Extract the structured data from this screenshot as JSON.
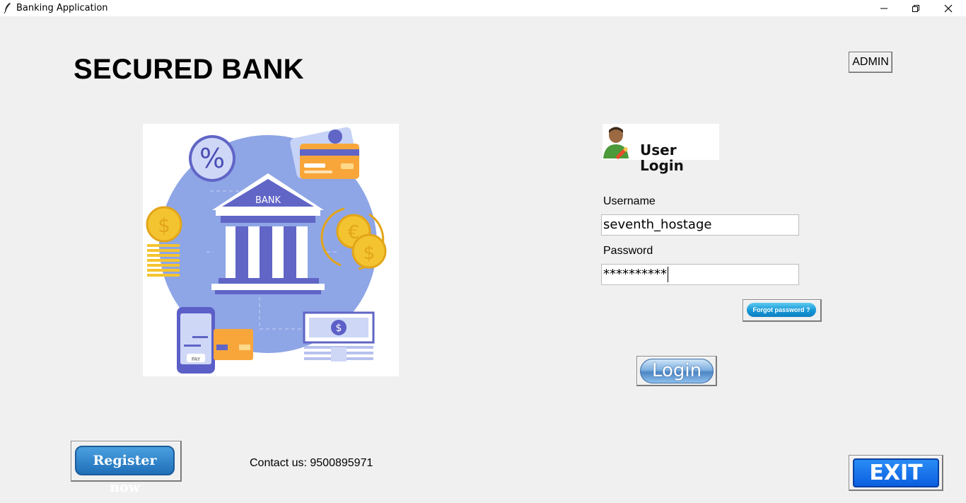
{
  "window": {
    "title": "Banking Application"
  },
  "header": {
    "title": "SECURED BANK",
    "admin_label": "ADMIN"
  },
  "illustration": {
    "bank_sign": "BANK",
    "percent_sign": "%",
    "pay_label": "PAY",
    "euro_sign": "€",
    "dollar_sign": "$"
  },
  "login": {
    "header_text": "User Login",
    "username_label": "Username",
    "username_value": "seventh_hostage",
    "password_label": "Password",
    "password_value": "**********",
    "forgot_label": "Forgot password ?",
    "login_label": "Login"
  },
  "footer": {
    "register_label": "Register now",
    "contact_text": "Contact us: 9500895971",
    "exit_label": "EXIT"
  },
  "colors": {
    "background": "#f0f0f0",
    "illustration_circle": "#8ea5e6",
    "bank_purple": "#5b5fc7",
    "coin_gold": "#f4c430",
    "card_orange": "#f8a63a",
    "exit_blue": "#0a5fe0"
  }
}
